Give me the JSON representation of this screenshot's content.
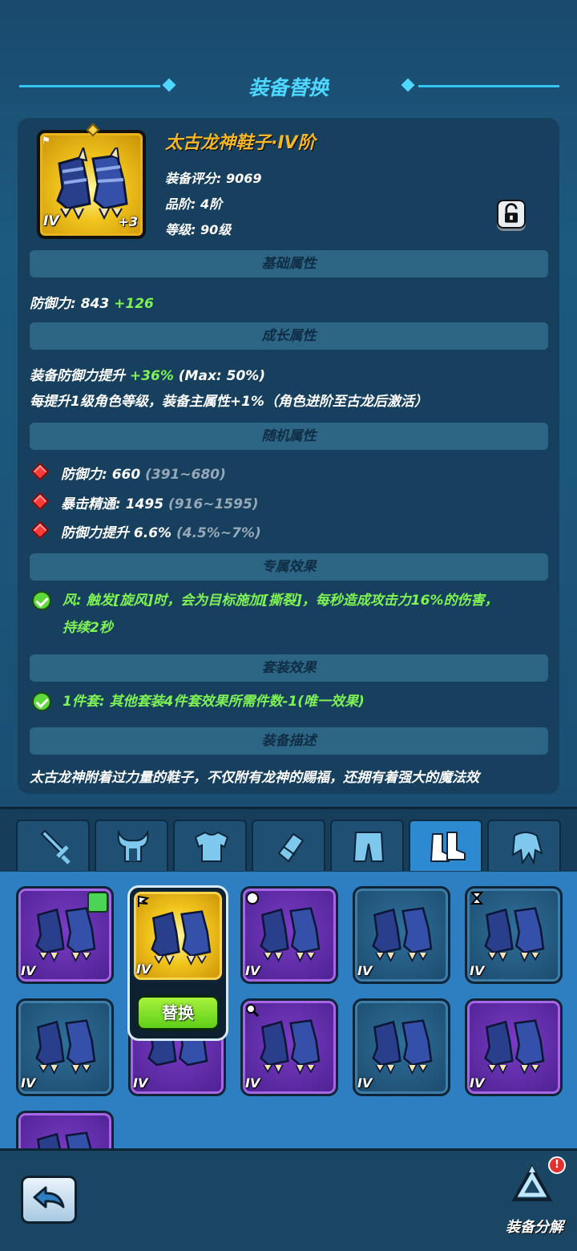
{
  "header": {
    "title": "装备替换"
  },
  "item": {
    "name": "太古龙神鞋子·IV阶",
    "tier": "IV",
    "plus": "+3",
    "score_label": "装备评分: 9069",
    "grade_label": "品阶: 4阶",
    "level_label": "等级: 90级"
  },
  "sections": {
    "base": "基础属性",
    "growth": "成长属性",
    "random": "随机属性",
    "exclusive": "专属效果",
    "set": "套装效果",
    "desc": "装备描述"
  },
  "base_attr": {
    "label": "防御力: 843",
    "bonus": "+126"
  },
  "growth_attr": {
    "line1_label": "装备防御力提升",
    "line1_bonus": "+36%",
    "line1_max": "(Max: 50%)",
    "line2": "每提升1级角色等级，装备主属性+1%（角色进阶至古龙后激活）"
  },
  "random_attrs": [
    {
      "label": "防御力: 660",
      "range": "(391~680)"
    },
    {
      "label": "暴击精通: 1495",
      "range": "(916~1595)"
    },
    {
      "label": "防御力提升 6.6%",
      "range": "(4.5%~7%)"
    }
  ],
  "exclusive_effect": {
    "line1": "风: 触发[旋风]时，会为目标施加[撕裂]，每秒造成攻击力16%的伤害，",
    "line2": "持续2秒"
  },
  "set_effect": "1件套: 其他套装4件套效果所需件数-1(唯一效果)",
  "description": "太古龙神附着过力量的鞋子，不仅附有龙神的赐福，还拥有着强大的魔法效",
  "tabs": [
    {
      "name": "weapon",
      "icon": "sword-icon"
    },
    {
      "name": "helmet",
      "icon": "horned-helmet-icon"
    },
    {
      "name": "armor",
      "icon": "chest-armor-icon"
    },
    {
      "name": "gloves",
      "icon": "bracer-icon"
    },
    {
      "name": "pants",
      "icon": "pants-icon"
    },
    {
      "name": "boots",
      "icon": "boots-icon",
      "active": true
    },
    {
      "name": "cloak",
      "icon": "cloak-icon"
    }
  ],
  "inventory": {
    "tier_label": "IV",
    "replace_label": "替换"
  },
  "bottom": {
    "salvage_label": "装备分解",
    "salvage_badge": "!"
  },
  "colors": {
    "accent": "#4fd8ff",
    "name_gold": "#f3b625",
    "bonus_green": "#7ff254",
    "purple_rarity": "#7a3bc4",
    "blue_rarity": "#2e6f99"
  }
}
